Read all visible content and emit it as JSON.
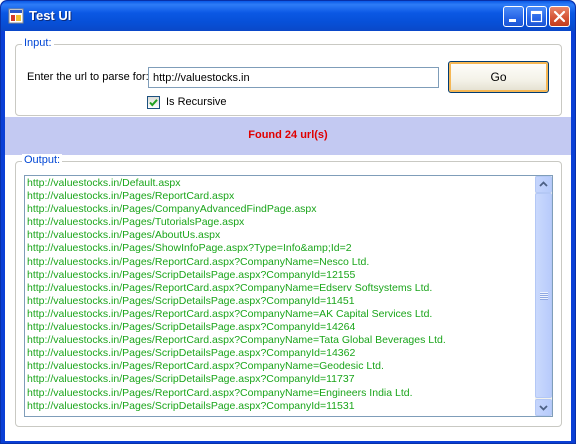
{
  "window": {
    "title": "Test UI"
  },
  "input_group": {
    "legend": "Input:",
    "url_label": "Enter the url to parse for:",
    "url_value": "http://valuestocks.in",
    "go_label": "Go",
    "recursive_label": "Is Recursive",
    "recursive_checked": true
  },
  "status": {
    "text": "Found 24 url(s)",
    "color": "#e00000"
  },
  "output_group": {
    "legend": "Output:",
    "item_color": "#1ba51b",
    "items": [
      "http://valuestocks.in/Default.aspx",
      "http://valuestocks.in/Pages/ReportCard.aspx",
      "http://valuestocks.in/Pages/CompanyAdvancedFindPage.aspx",
      "http://valuestocks.in/Pages/TutorialsPage.aspx",
      "http://valuestocks.in/Pages/AboutUs.aspx",
      "http://valuestocks.in/Pages/ShowInfoPage.aspx?Type=Info&amp;Id=2",
      "http://valuestocks.in/Pages/ReportCard.aspx?CompanyName=Nesco Ltd.",
      "http://valuestocks.in/Pages/ScripDetailsPage.aspx?CompanyId=12155",
      "http://valuestocks.in/Pages/ReportCard.aspx?CompanyName=Edserv Softsystems Ltd.",
      "http://valuestocks.in/Pages/ScripDetailsPage.aspx?CompanyId=11451",
      "http://valuestocks.in/Pages/ReportCard.aspx?CompanyName=AK Capital Services Ltd.",
      "http://valuestocks.in/Pages/ScripDetailsPage.aspx?CompanyId=14264",
      "http://valuestocks.in/Pages/ReportCard.aspx?CompanyName=Tata Global Beverages Ltd.",
      "http://valuestocks.in/Pages/ScripDetailsPage.aspx?CompanyId=14362",
      "http://valuestocks.in/Pages/ReportCard.aspx?CompanyName=Geodesic Ltd.",
      "http://valuestocks.in/Pages/ScripDetailsPage.aspx?CompanyId=11737",
      "http://valuestocks.in/Pages/ReportCard.aspx?CompanyName=Engineers India Ltd.",
      "http://valuestocks.in/Pages/ScripDetailsPage.aspx?CompanyId=11531"
    ]
  }
}
